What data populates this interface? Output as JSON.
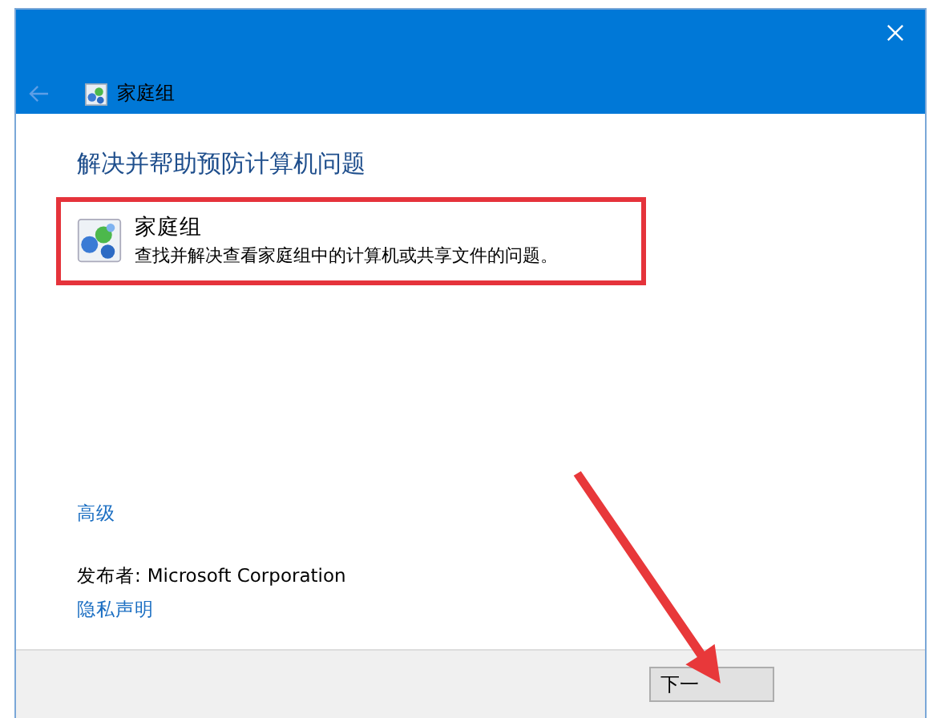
{
  "window": {
    "title": "家庭组"
  },
  "heading": "解决并帮助预防计算机问题",
  "item": {
    "title": "家庭组",
    "description": "查找并解决查看家庭组中的计算机或共享文件的问题。"
  },
  "advanced_link": "高级",
  "publisher": {
    "label": "发布者:",
    "value": "Microsoft Corporation"
  },
  "privacy_link": "隐私声明",
  "buttons": [
    {
      "label": "下一"
    }
  ]
}
